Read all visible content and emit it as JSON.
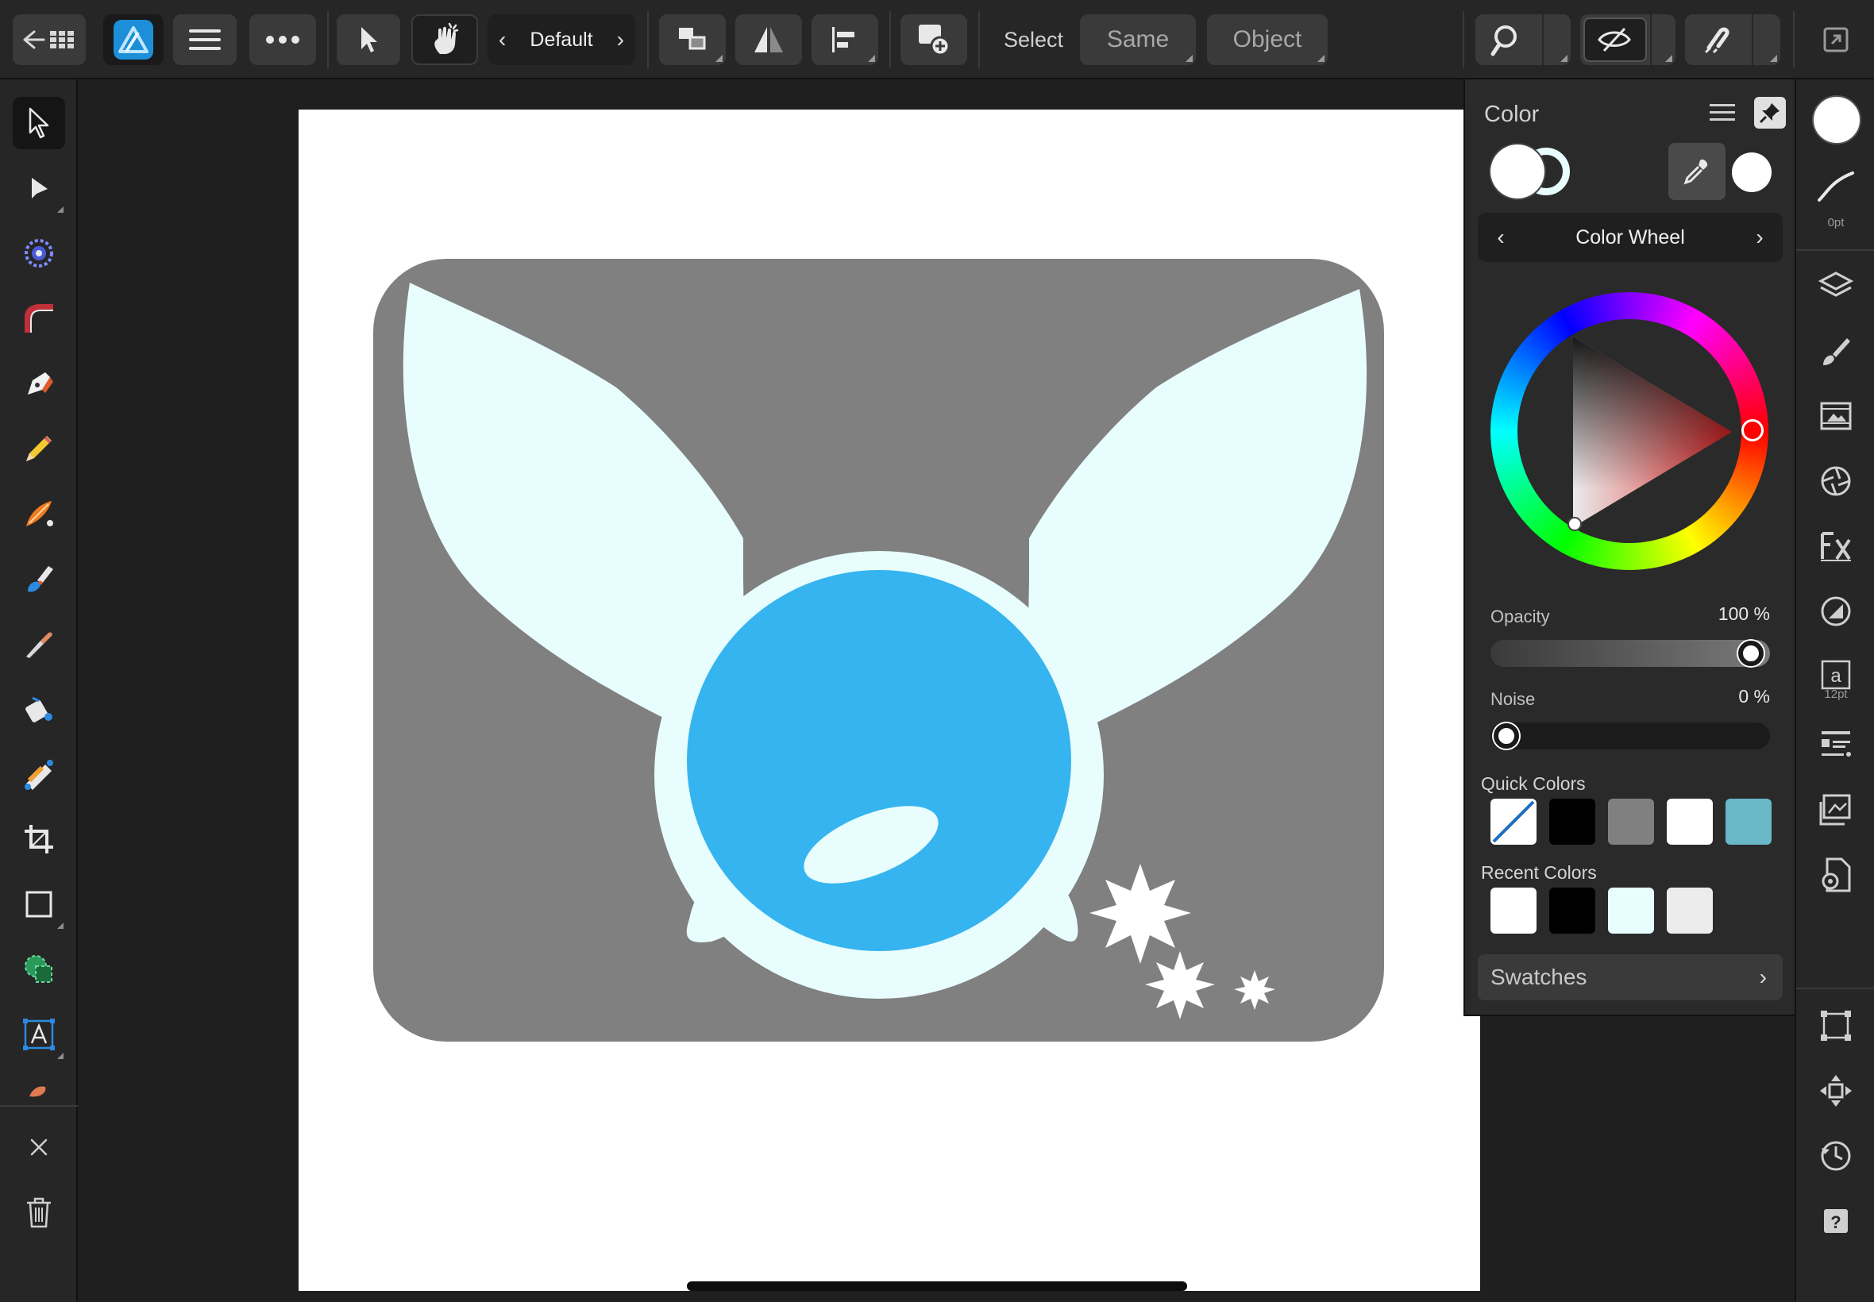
{
  "topbar": {
    "context_preset": "Default",
    "select_label": "Select",
    "same_label": "Same",
    "object_label": "Object"
  },
  "color_panel": {
    "title": "Color",
    "mode": "Color Wheel",
    "opacity_label": "Opacity",
    "opacity_value": "100 %",
    "opacity": 1.0,
    "noise_label": "Noise",
    "noise_value": "0 %",
    "noise": 0.0,
    "quick_colors_label": "Quick Colors",
    "quick_colors": [
      "none",
      "#000000",
      "#808080",
      "#ffffff",
      "#68b8c8"
    ],
    "recent_colors_label": "Recent Colors",
    "recent_colors": [
      "#ffffff",
      "#000000",
      "#e8fdfd",
      "#ececec"
    ],
    "swatches_label": "Swatches",
    "fill_color": "#ffffff",
    "stroke_color": "#e8fdfd",
    "wheel_hue_color": "#e02020"
  },
  "right_strip": {
    "stroke_width": "0pt",
    "text_size": "12pt"
  },
  "canvas": {
    "artboard_color": "#ffffff",
    "card_color": "#808080",
    "wing_color": "#e8fdfd",
    "orb_color": "#36b4ef"
  }
}
